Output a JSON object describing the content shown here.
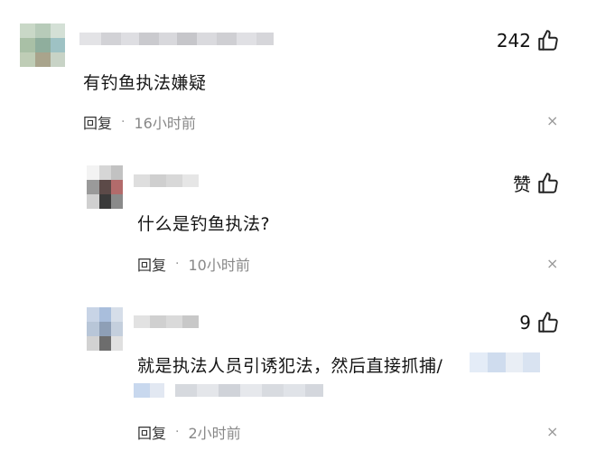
{
  "comments": [
    {
      "like_value": "242",
      "text": "有钓鱼执法嫌疑",
      "reply_label": "回复",
      "separator": "·",
      "time": "16小时前",
      "close_glyph": "×"
    },
    {
      "like_value": "赞",
      "text": "什么是钓鱼执法?",
      "reply_label": "回复",
      "separator": "·",
      "time": "10小时前",
      "close_glyph": "×"
    },
    {
      "like_value": "9",
      "text": "就是执法人员引诱犯法，然后直接抓捕/",
      "reply_label": "回复",
      "separator": "·",
      "time": "2小时前",
      "close_glyph": "×"
    }
  ],
  "icons": {
    "like": "thumbs-up-icon",
    "close": "close-icon"
  }
}
